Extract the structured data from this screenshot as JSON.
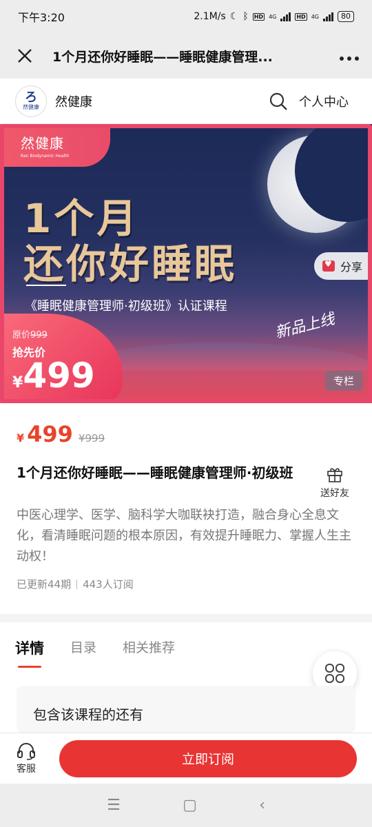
{
  "status_bar": {
    "time": "下午3:20",
    "speed": "2.1M/s",
    "net1": "4G",
    "net2": "4G",
    "battery": "80"
  },
  "titlebar": {
    "title": "1个月还你好睡眠——睡眠健康管理..."
  },
  "shop": {
    "logo_mark": "ろ",
    "logo_name": "然健康",
    "name": "然健康",
    "user_center": "个人中心"
  },
  "banner": {
    "brand": "然健康",
    "brand_sub": "Ran Biodynamic Health",
    "share": "分享",
    "headline1": "1个月",
    "headline2": "还你好睡眠",
    "subhead": "《睡眠健康管理师·初级班》认证课程",
    "new_tag": "新品上线",
    "orig_label": "原价",
    "orig_price": "999",
    "grab_label": "抢先价",
    "currency": "¥",
    "price": "499",
    "column_tag": "专栏"
  },
  "product": {
    "currency": "¥",
    "price": "499",
    "old_price": "¥999",
    "title": "1个月还你好睡眠——睡眠健康管理师·初级班",
    "gift_label": "送好友",
    "description": "中医心理学、医学、脑科学大咖联袂打造，融合身心全息文化，看清睡眠问题的根本原因，有效提升睡眠力、掌握人生主动权！",
    "updated": "已更新44期",
    "subscribers": "443人订阅"
  },
  "tabs": [
    {
      "label": "详情",
      "active": true
    },
    {
      "label": "目录",
      "active": false
    },
    {
      "label": "相关推荐",
      "active": false
    }
  ],
  "card": {
    "text": "包含该课程的还有"
  },
  "bottom": {
    "service_label": "客服",
    "subscribe_label": "立即订阅"
  },
  "nav": {
    "menu": "☰",
    "home": "▢",
    "back": "‹"
  },
  "colors": {
    "accent": "#e93434",
    "price": "#e8442c",
    "banner_dark": "#1c2a58",
    "banner_pink": "#e8476a"
  }
}
